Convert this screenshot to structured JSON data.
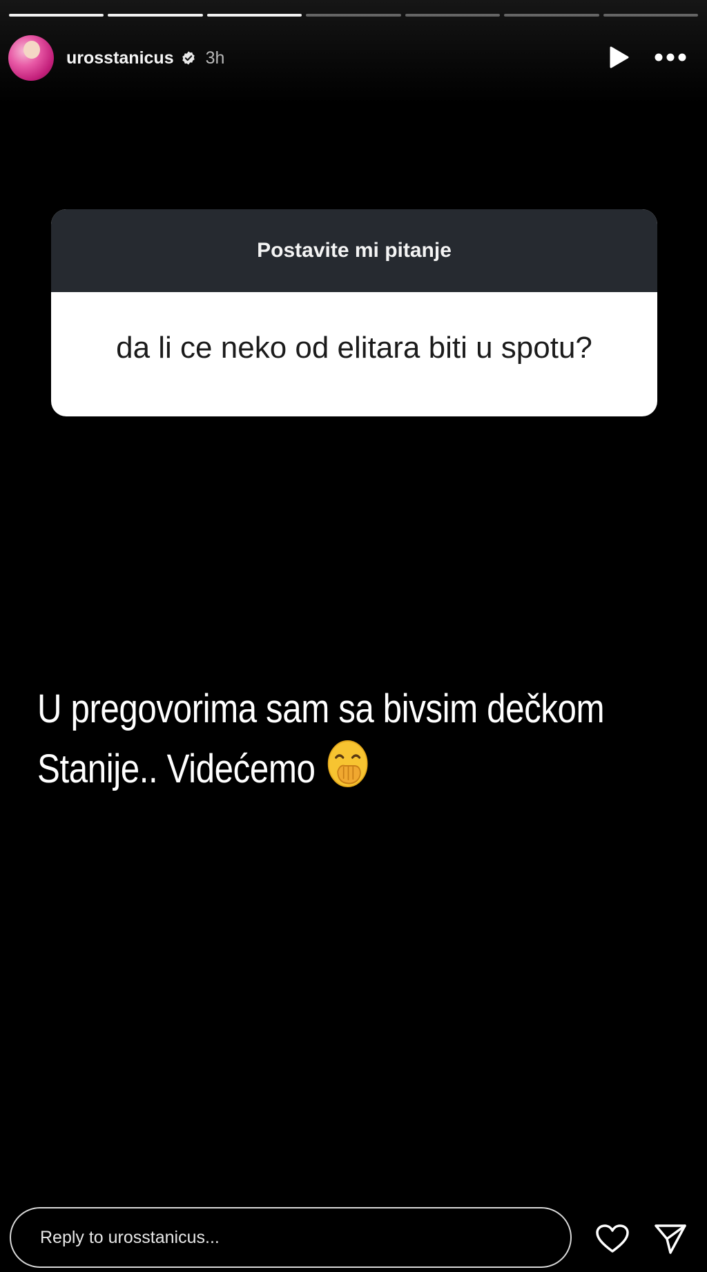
{
  "story": {
    "progress": {
      "total_segments": 7,
      "completed_segments": 3
    },
    "header": {
      "username": "urosstanicus",
      "time": "3h",
      "avatar_icon": "profile-avatar"
    },
    "question_sticker": {
      "title": "Postavite mi pitanje",
      "question": "da li ce neko od elitara biti u spotu?"
    },
    "answer_text": {
      "line1": "U pregovorima sam sa bivsim dečkom",
      "line2": "Stanije..  Videćemo",
      "emoji": "face-with-hand-over-mouth-emoji"
    },
    "reply": {
      "placeholder": "Reply to urosstanicus..."
    }
  },
  "colors": {
    "background": "#000000",
    "sticker_header": "#262a30",
    "sticker_body": "#ffffff",
    "emoji_yellow": "#f7c431"
  }
}
